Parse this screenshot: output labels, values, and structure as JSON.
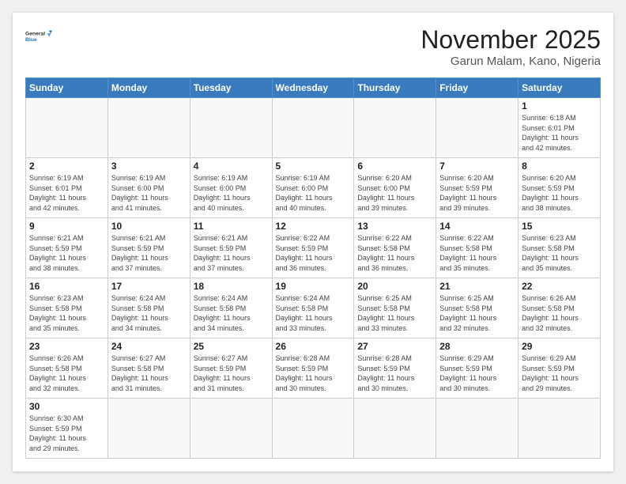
{
  "header": {
    "logo_line1": "General",
    "logo_line2": "Blue",
    "month_year": "November 2025",
    "location": "Garun Malam, Kano, Nigeria"
  },
  "weekdays": [
    "Sunday",
    "Monday",
    "Tuesday",
    "Wednesday",
    "Thursday",
    "Friday",
    "Saturday"
  ],
  "weeks": [
    [
      {
        "day": "",
        "info": ""
      },
      {
        "day": "",
        "info": ""
      },
      {
        "day": "",
        "info": ""
      },
      {
        "day": "",
        "info": ""
      },
      {
        "day": "",
        "info": ""
      },
      {
        "day": "",
        "info": ""
      },
      {
        "day": "1",
        "info": "Sunrise: 6:18 AM\nSunset: 6:01 PM\nDaylight: 11 hours\nand 42 minutes."
      }
    ],
    [
      {
        "day": "2",
        "info": "Sunrise: 6:19 AM\nSunset: 6:01 PM\nDaylight: 11 hours\nand 42 minutes."
      },
      {
        "day": "3",
        "info": "Sunrise: 6:19 AM\nSunset: 6:00 PM\nDaylight: 11 hours\nand 41 minutes."
      },
      {
        "day": "4",
        "info": "Sunrise: 6:19 AM\nSunset: 6:00 PM\nDaylight: 11 hours\nand 40 minutes."
      },
      {
        "day": "5",
        "info": "Sunrise: 6:19 AM\nSunset: 6:00 PM\nDaylight: 11 hours\nand 40 minutes."
      },
      {
        "day": "6",
        "info": "Sunrise: 6:20 AM\nSunset: 6:00 PM\nDaylight: 11 hours\nand 39 minutes."
      },
      {
        "day": "7",
        "info": "Sunrise: 6:20 AM\nSunset: 5:59 PM\nDaylight: 11 hours\nand 39 minutes."
      },
      {
        "day": "8",
        "info": "Sunrise: 6:20 AM\nSunset: 5:59 PM\nDaylight: 11 hours\nand 38 minutes."
      }
    ],
    [
      {
        "day": "9",
        "info": "Sunrise: 6:21 AM\nSunset: 5:59 PM\nDaylight: 11 hours\nand 38 minutes."
      },
      {
        "day": "10",
        "info": "Sunrise: 6:21 AM\nSunset: 5:59 PM\nDaylight: 11 hours\nand 37 minutes."
      },
      {
        "day": "11",
        "info": "Sunrise: 6:21 AM\nSunset: 5:59 PM\nDaylight: 11 hours\nand 37 minutes."
      },
      {
        "day": "12",
        "info": "Sunrise: 6:22 AM\nSunset: 5:59 PM\nDaylight: 11 hours\nand 36 minutes."
      },
      {
        "day": "13",
        "info": "Sunrise: 6:22 AM\nSunset: 5:58 PM\nDaylight: 11 hours\nand 36 minutes."
      },
      {
        "day": "14",
        "info": "Sunrise: 6:22 AM\nSunset: 5:58 PM\nDaylight: 11 hours\nand 35 minutes."
      },
      {
        "day": "15",
        "info": "Sunrise: 6:23 AM\nSunset: 5:58 PM\nDaylight: 11 hours\nand 35 minutes."
      }
    ],
    [
      {
        "day": "16",
        "info": "Sunrise: 6:23 AM\nSunset: 5:58 PM\nDaylight: 11 hours\nand 35 minutes."
      },
      {
        "day": "17",
        "info": "Sunrise: 6:24 AM\nSunset: 5:58 PM\nDaylight: 11 hours\nand 34 minutes."
      },
      {
        "day": "18",
        "info": "Sunrise: 6:24 AM\nSunset: 5:58 PM\nDaylight: 11 hours\nand 34 minutes."
      },
      {
        "day": "19",
        "info": "Sunrise: 6:24 AM\nSunset: 5:58 PM\nDaylight: 11 hours\nand 33 minutes."
      },
      {
        "day": "20",
        "info": "Sunrise: 6:25 AM\nSunset: 5:58 PM\nDaylight: 11 hours\nand 33 minutes."
      },
      {
        "day": "21",
        "info": "Sunrise: 6:25 AM\nSunset: 5:58 PM\nDaylight: 11 hours\nand 32 minutes."
      },
      {
        "day": "22",
        "info": "Sunrise: 6:26 AM\nSunset: 5:58 PM\nDaylight: 11 hours\nand 32 minutes."
      }
    ],
    [
      {
        "day": "23",
        "info": "Sunrise: 6:26 AM\nSunset: 5:58 PM\nDaylight: 11 hours\nand 32 minutes."
      },
      {
        "day": "24",
        "info": "Sunrise: 6:27 AM\nSunset: 5:58 PM\nDaylight: 11 hours\nand 31 minutes."
      },
      {
        "day": "25",
        "info": "Sunrise: 6:27 AM\nSunset: 5:59 PM\nDaylight: 11 hours\nand 31 minutes."
      },
      {
        "day": "26",
        "info": "Sunrise: 6:28 AM\nSunset: 5:59 PM\nDaylight: 11 hours\nand 30 minutes."
      },
      {
        "day": "27",
        "info": "Sunrise: 6:28 AM\nSunset: 5:59 PM\nDaylight: 11 hours\nand 30 minutes."
      },
      {
        "day": "28",
        "info": "Sunrise: 6:29 AM\nSunset: 5:59 PM\nDaylight: 11 hours\nand 30 minutes."
      },
      {
        "day": "29",
        "info": "Sunrise: 6:29 AM\nSunset: 5:59 PM\nDaylight: 11 hours\nand 29 minutes."
      }
    ],
    [
      {
        "day": "30",
        "info": "Sunrise: 6:30 AM\nSunset: 5:59 PM\nDaylight: 11 hours\nand 29 minutes."
      },
      {
        "day": "",
        "info": ""
      },
      {
        "day": "",
        "info": ""
      },
      {
        "day": "",
        "info": ""
      },
      {
        "day": "",
        "info": ""
      },
      {
        "day": "",
        "info": ""
      },
      {
        "day": "",
        "info": ""
      }
    ]
  ]
}
